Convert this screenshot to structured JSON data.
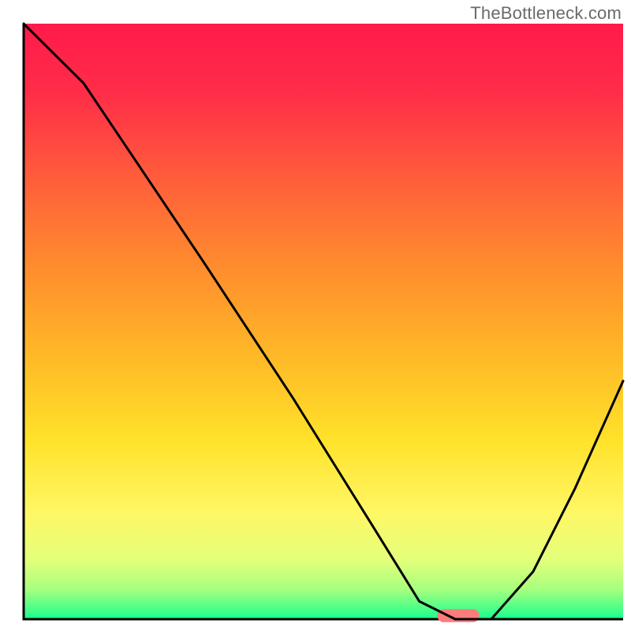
{
  "watermark": "TheBottleneck.com",
  "chart_data": {
    "type": "line",
    "title": "",
    "xlabel": "",
    "ylabel": "",
    "xlim": [
      0,
      100
    ],
    "ylim": [
      0,
      100
    ],
    "grid": false,
    "background_gradient": {
      "stops": [
        {
          "offset": 0.0,
          "color": "#ff1a4b"
        },
        {
          "offset": 0.12,
          "color": "#ff2e48"
        },
        {
          "offset": 0.25,
          "color": "#ff5a3c"
        },
        {
          "offset": 0.4,
          "color": "#ff8a2e"
        },
        {
          "offset": 0.55,
          "color": "#ffb627"
        },
        {
          "offset": 0.7,
          "color": "#ffe22a"
        },
        {
          "offset": 0.82,
          "color": "#fff765"
        },
        {
          "offset": 0.9,
          "color": "#e4ff7a"
        },
        {
          "offset": 0.95,
          "color": "#a7ff7e"
        },
        {
          "offset": 1.0,
          "color": "#18ff8e"
        }
      ]
    },
    "series": [
      {
        "name": "bottleneck-curve",
        "color": "#000000",
        "x": [
          0,
          10,
          18,
          30,
          45,
          58,
          66,
          72,
          78,
          85,
          92,
          100
        ],
        "values": [
          100,
          90,
          78,
          60,
          37,
          16,
          3,
          0,
          0,
          8,
          22,
          40
        ]
      }
    ],
    "marker": {
      "name": "optimal-range",
      "color": "#ff7b7b",
      "x_start": 69,
      "x_end": 76,
      "y": 0.6,
      "thickness": 2.2
    }
  }
}
